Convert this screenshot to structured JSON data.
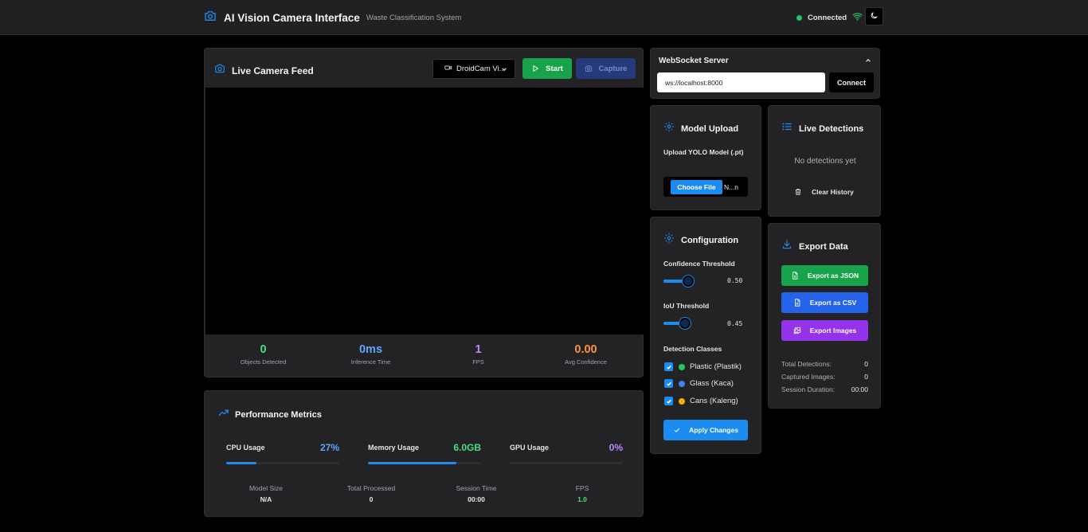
{
  "header": {
    "title": "AI Vision Camera Interface",
    "subtitle": "Waste Classification System",
    "status": "Connected",
    "status_color": "#22c55e",
    "icons": {
      "camera": "camera-icon",
      "wifi": "wifi-icon",
      "theme": "moon-icon"
    }
  },
  "camera": {
    "title": "Live Camera Feed",
    "device": "DroidCam Vi...",
    "start_label": "Start",
    "capture_label": "Capture",
    "stats": [
      {
        "value": "0",
        "label": "Objects Detected",
        "color": "#4ade80"
      },
      {
        "value": "0ms",
        "label": "Inference Time",
        "color": "#60a5fa"
      },
      {
        "value": "1",
        "label": "FPS",
        "color": "#c084fc"
      },
      {
        "value": "0.00",
        "label": "Avg Confidence",
        "color": "#fb923c"
      }
    ]
  },
  "performance": {
    "title": "Performance Metrics",
    "metrics": [
      {
        "label": "CPU Usage",
        "value": "27%",
        "fraction": 0.27,
        "color": "#60a5fa",
        "bar_color": "#1d8cf0"
      },
      {
        "label": "Memory Usage",
        "value": "6.0GB",
        "fraction": 0.78,
        "color": "#4ade80",
        "bar_color": "#1d8cf0"
      },
      {
        "label": "GPU Usage",
        "value": "0%",
        "fraction": 0.0,
        "color": "#c084fc",
        "bar_color": "#1d8cf0"
      }
    ],
    "stats": [
      {
        "label": "Model Size",
        "value": "N/A",
        "color": "#e5e5e5"
      },
      {
        "label": "Total Processed",
        "value": "0",
        "color": "#e5e5e5"
      },
      {
        "label": "Session Time",
        "value": "00:00",
        "color": "#e5e5e5"
      },
      {
        "label": "FPS",
        "value": "1.0",
        "color": "#4ade80"
      }
    ]
  },
  "websocket": {
    "title": "WebSocket Server",
    "url": "ws://localhost:8000",
    "connect_label": "Connect"
  },
  "model_upload": {
    "title": "Model Upload",
    "label": "Upload YOLO Model (.pt)",
    "choose_label": "Choose File",
    "file_text": "N...n"
  },
  "detections": {
    "title": "Live Detections",
    "empty_text": "No detections yet",
    "clear_label": "Clear History"
  },
  "configuration": {
    "title": "Configuration",
    "confidence_label": "Confidence Threshold",
    "confidence_value": "0.50",
    "iou_label": "IoU Threshold",
    "iou_value": "0.45",
    "classes_label": "Detection Classes",
    "classes": [
      {
        "name": "Plastic (Plastik)",
        "color": "#22c55e",
        "checked": true
      },
      {
        "name": "Glass (Kaca)",
        "color": "#3b82f6",
        "checked": true
      },
      {
        "name": "Cans (Kaleng)",
        "color": "#eab308",
        "checked": true
      }
    ],
    "apply_label": "Apply Changes"
  },
  "export": {
    "title": "Export Data",
    "buttons": [
      {
        "label": "Export as JSON",
        "color": "#16a34a"
      },
      {
        "label": "Export as CSV",
        "color": "#2563eb"
      },
      {
        "label": "Export Images",
        "color": "#9333ea"
      }
    ],
    "stats": [
      {
        "label": "Total Detections:",
        "value": "0"
      },
      {
        "label": "Captured Images:",
        "value": "0"
      },
      {
        "label": "Session Duration:",
        "value": "00:00"
      }
    ]
  },
  "accent": "#1d8cf0"
}
